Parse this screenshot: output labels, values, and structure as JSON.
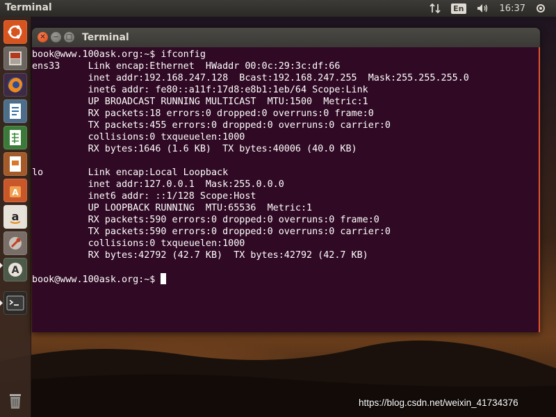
{
  "top_panel": {
    "app_title": "Terminal",
    "keyboard_layout": "En",
    "clock": "16:37"
  },
  "launcher": {
    "items": [
      {
        "name": "ubuntu-dash",
        "icon": "ubuntu-logo-icon"
      },
      {
        "name": "files",
        "icon": "file-cabinet-icon"
      },
      {
        "name": "firefox",
        "icon": "firefox-icon"
      },
      {
        "name": "writer",
        "icon": "document-icon"
      },
      {
        "name": "calc",
        "icon": "spreadsheet-icon"
      },
      {
        "name": "impress",
        "icon": "presentation-icon"
      },
      {
        "name": "software-center",
        "icon": "shopping-bag-icon"
      },
      {
        "name": "amazon",
        "icon": "amazon-icon"
      },
      {
        "name": "system-settings",
        "icon": "wrench-icon"
      },
      {
        "name": "software-updater",
        "icon": "updater-icon"
      },
      {
        "name": "terminal",
        "icon": "terminal-icon"
      },
      {
        "name": "trash",
        "icon": "trash-icon"
      }
    ]
  },
  "window": {
    "title": "Terminal"
  },
  "terminal": {
    "lines": [
      "book@www.100ask.org:~$ ifconfig",
      "ens33     Link encap:Ethernet  HWaddr 00:0c:29:3c:df:66  ",
      "          inet addr:192.168.247.128  Bcast:192.168.247.255  Mask:255.255.255.0",
      "          inet6 addr: fe80::a11f:17d8:e8b1:1eb/64 Scope:Link",
      "          UP BROADCAST RUNNING MULTICAST  MTU:1500  Metric:1",
      "          RX packets:18 errors:0 dropped:0 overruns:0 frame:0",
      "          TX packets:455 errors:0 dropped:0 overruns:0 carrier:0",
      "          collisions:0 txqueuelen:1000 ",
      "          RX bytes:1646 (1.6 KB)  TX bytes:40006 (40.0 KB)",
      "",
      "lo        Link encap:Local Loopback  ",
      "          inet addr:127.0.0.1  Mask:255.0.0.0",
      "          inet6 addr: ::1/128 Scope:Host",
      "          UP LOOPBACK RUNNING  MTU:65536  Metric:1",
      "          RX packets:590 errors:0 dropped:0 overruns:0 frame:0",
      "          TX packets:590 errors:0 dropped:0 overruns:0 carrier:0",
      "          collisions:0 txqueuelen:1000 ",
      "          RX bytes:42792 (42.7 KB)  TX bytes:42792 (42.7 KB)",
      ""
    ],
    "prompt": "book@www.100ask.org:~$ "
  },
  "watermark": "https://blog.csdn.net/weixin_41734376",
  "colors": {
    "terminal_bg": "#300a24",
    "terminal_fg": "#ffffff",
    "accent": "#e4532e"
  }
}
